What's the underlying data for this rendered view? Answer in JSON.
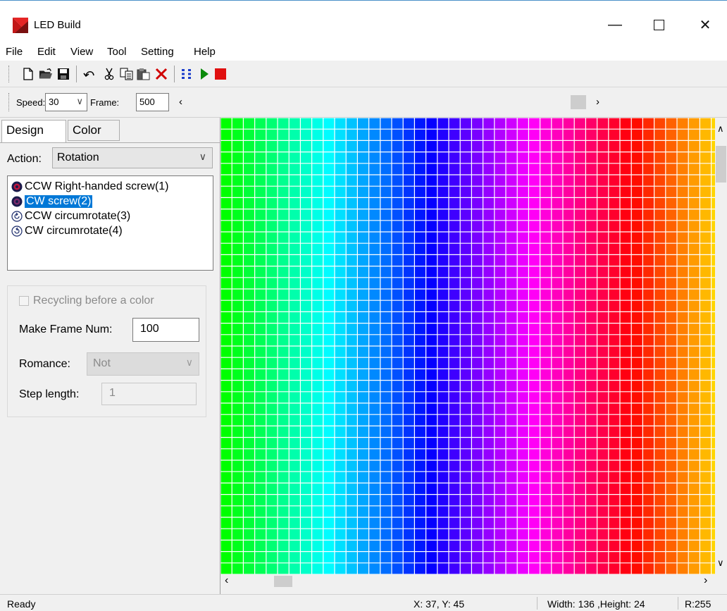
{
  "window": {
    "title": "LED Build"
  },
  "menu": [
    "File",
    "Edit",
    "View",
    "Tool",
    "Setting",
    "Help"
  ],
  "toolbar": {
    "icons": [
      "new-file-icon",
      "open-folder-icon",
      "save-icon",
      "undo-icon",
      "cut-icon",
      "copy-icon",
      "paste-icon",
      "delete-icon",
      "grid-icon",
      "play-icon",
      "stop-icon"
    ],
    "colors": {
      "play": "#0a8a0a",
      "stop": "#e01010",
      "delete": "#d00000"
    }
  },
  "toolbar2": {
    "speed_label": "Speed:",
    "speed_value": "30",
    "frame_label": "Frame:",
    "frame_value": "500"
  },
  "tabs": [
    "Design",
    "Color"
  ],
  "design": {
    "action_label": "Action:",
    "action_value": "Rotation",
    "actions": [
      {
        "label": "CCW Right-handed screw(1)",
        "icon": "ccw-screw-icon"
      },
      {
        "label": "CW screw(2)",
        "icon": "cw-screw-icon",
        "selected": true
      },
      {
        "label": "CCW circumrotate(3)",
        "icon": "ccw-rotate-icon"
      },
      {
        "label": "CW circumrotate(4)",
        "icon": "cw-rotate-icon"
      }
    ],
    "recycling_label": "Recycling before a color",
    "frame_num_label": "Make Frame Num:",
    "frame_num_value": "100",
    "romance_label": "Romance:",
    "romance_value": "Not",
    "step_label": "Step length:",
    "step_value": "1"
  },
  "status": {
    "ready": "Ready",
    "coords": "X: 37, Y: 45",
    "size": "Width: 136 ,Height: 24",
    "rgb": "R:255"
  }
}
